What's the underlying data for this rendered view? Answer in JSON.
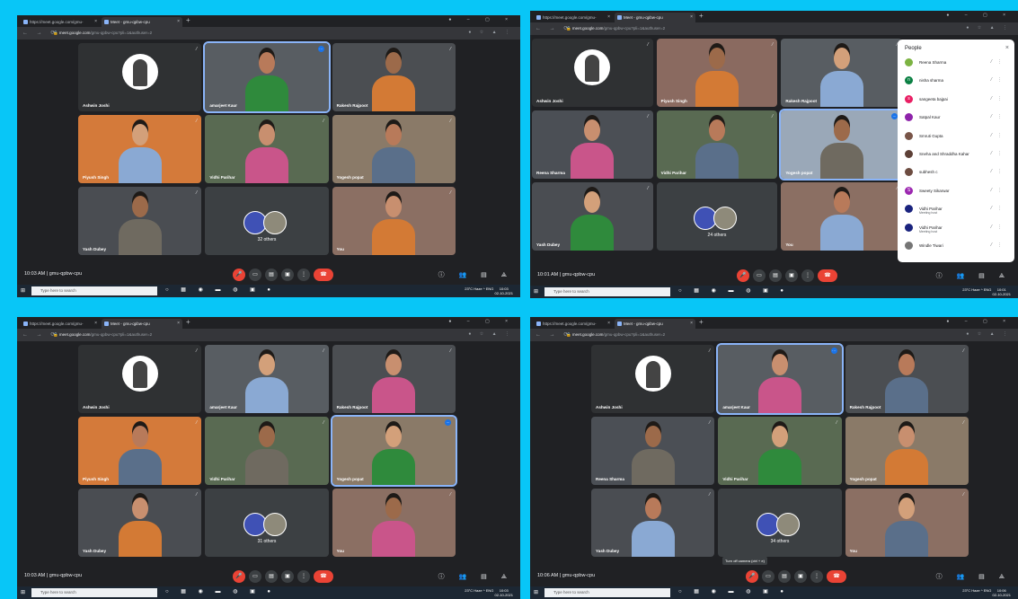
{
  "browser": {
    "tab1": "https://meet.google.com/gmu-",
    "tab2": "Meet - gmu-qpbw-cpu",
    "url_host": "meet.google.com",
    "url_path": "/gmu-qpbw-cpu?pli=1&authuser=2"
  },
  "meeting": {
    "code": "gmu-qpbw-cpu"
  },
  "taskbar": {
    "search_placeholder": "Type here to search",
    "weather": "23°C Haze",
    "lang": "ENG"
  },
  "screens": [
    {
      "time": "10:03 AM",
      "tray_time": "10:03",
      "tray_date": "02-10-2021",
      "names": [
        "Ashwin Joshi",
        "amarjeet Kaur",
        "Rakesh Rajpoot",
        "Piyush Singh",
        "Vidhi Parihar",
        "Yogesh popat",
        "Yash Dubey",
        "32 others",
        "You"
      ]
    },
    {
      "time": "10:01 AM",
      "tray_time": "10:01",
      "tray_date": "02-10-2021",
      "names": [
        "Ashwin Joshi",
        "Piyush Singh",
        "Rakesh Rajpoot",
        "Reena Sharma",
        "Vidhi Parihar",
        "Yogesh popat",
        "Yash Dubey",
        "24 others",
        "You"
      ]
    },
    {
      "time": "10:03 AM",
      "tray_time": "10:03",
      "tray_date": "02-10-2021",
      "names": [
        "Ashwin Joshi",
        "amarjeet Kaur",
        "Rakesh Rajpoot",
        "Piyush Singh",
        "Vidhi Parihar",
        "Yogesh popat",
        "Yash Dubey",
        "31 others",
        "You"
      ]
    },
    {
      "time": "10:06 AM",
      "tray_time": "10:06",
      "tray_date": "02-10-2021",
      "names": [
        "Ashwin Joshi",
        "amarjeet Kaur",
        "Rakesh Rajpoot",
        "Reena Sharma",
        "Vidhi Parihar",
        "Yogesh popat",
        "Yash Dubey",
        "34 others",
        "You"
      ],
      "tooltip": "Turn off camera (ctrl + e)"
    }
  ],
  "people_panel": {
    "title": "People",
    "list": [
      {
        "name": "Reena Sharma",
        "initial": "",
        "color": "#7cb342"
      },
      {
        "name": "nisha sharma",
        "initial": "n",
        "color": "#0b8043"
      },
      {
        "name": "sangeeta bajpai",
        "initial": "s",
        "color": "#e91e63"
      },
      {
        "name": "Satpal Kaur",
        "initial": "",
        "color": "#8e24aa"
      },
      {
        "name": "Smruti Gupta",
        "initial": "",
        "color": "#795548"
      },
      {
        "name": "Sneha and Shraddha Kahar",
        "initial": "",
        "color": "#5d4037"
      },
      {
        "name": "subhesh c",
        "initial": "",
        "color": "#6d4c41"
      },
      {
        "name": "Sweety Sikarwar",
        "initial": "S",
        "color": "#9c27b0"
      },
      {
        "name": "Vidhi Parihar",
        "sub": "Meeting host",
        "initial": "",
        "color": "#1a237e"
      },
      {
        "name": "Vidhi Parihar",
        "sub": "Meeting host",
        "initial": "",
        "color": "#1a237e"
      },
      {
        "name": "Windle Tiwari",
        "initial": "",
        "color": "#757575"
      }
    ]
  }
}
